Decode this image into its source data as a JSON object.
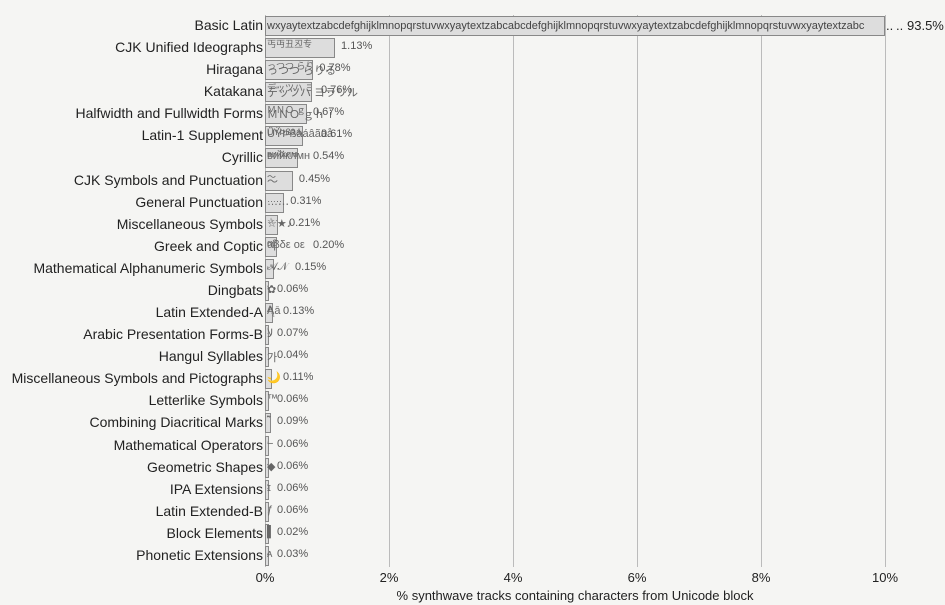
{
  "chart_data": {
    "type": "bar",
    "orientation": "horizontal",
    "title": "",
    "xlabel": "% synthwave tracks containing characters from Unicode block",
    "ylabel": "",
    "xlim": [
      0,
      10
    ],
    "x_ticks": [
      0,
      2,
      4,
      6,
      8,
      10
    ],
    "x_tick_labels": [
      "0%",
      "2%",
      "4%",
      "6%",
      "8%",
      "10%"
    ],
    "axis_break_after": 10,
    "off_scale_value": 93.5,
    "categories": [
      "Basic Latin",
      "CJK Unified Ideographs",
      "Hiragana",
      "Katakana",
      "Halfwidth and Fullwidth Forms",
      "Latin-1 Supplement",
      "Cyrillic",
      "CJK Symbols and Punctuation",
      "General Punctuation",
      "Miscellaneous Symbols",
      "Greek and Coptic",
      "Mathematical Alphanumeric Symbols",
      "Dingbats",
      "Latin Extended-A",
      "Arabic Presentation Forms-B",
      "Hangul Syllables",
      "Miscellaneous Symbols and Pictographs",
      "Letterlike Symbols",
      "Combining Diacritical Marks",
      "Mathematical Operators",
      "Geometric Shapes",
      "IPA Extensions",
      "Latin Extended-B",
      "Block Elements",
      "Phonetic Extensions"
    ],
    "values": [
      93.5,
      1.13,
      0.78,
      0.76,
      0.67,
      0.61,
      0.54,
      0.45,
      0.31,
      0.21,
      0.2,
      0.15,
      0.06,
      0.13,
      0.07,
      0.04,
      0.11,
      0.06,
      0.09,
      0.06,
      0.06,
      0.06,
      0.06,
      0.02,
      0.03
    ],
    "value_labels": [
      "93.5%",
      "1.13%",
      "0.78%",
      "0.76%",
      "0.67%",
      "0.61%",
      "0.54%",
      "0.45%",
      "0.31%",
      "0.21%",
      "0.20%",
      "0.15%",
      "0.06%",
      "0.13%",
      "0.07%",
      "0.04%",
      "0.11%",
      "0.06%",
      "0.09%",
      "0.06%",
      "0.06%",
      "0.06%",
      "0.06%",
      "0.02%",
      "0.03%"
    ],
    "bar_samples": [
      "wxyaytextzabcdefghijklmnopqrstuvwxyaytextzabcabcdefghijklmnopqrstuvwxyaytextzabcdefghijklmnopqrstuvwxyaytextzabc",
      "丐丏丑丒专",
      "っつつ  らりる",
      "デッツハ  ヨラリル",
      "ＭＮＯ ｇｈｉ",
      "ÜÝÞßàáâãäå",
      "вийклмн",
      "〜",
      "…‥․",
      "☆★♪",
      "αβδε οε",
      "𝒜𝒩",
      "✿",
      "Ąā",
      "ﻻ",
      "가",
      "🌙",
      "™",
      "̃",
      "−",
      "◆",
      "ɪ",
      "ƒ",
      "▌",
      "ᴀ"
    ]
  }
}
